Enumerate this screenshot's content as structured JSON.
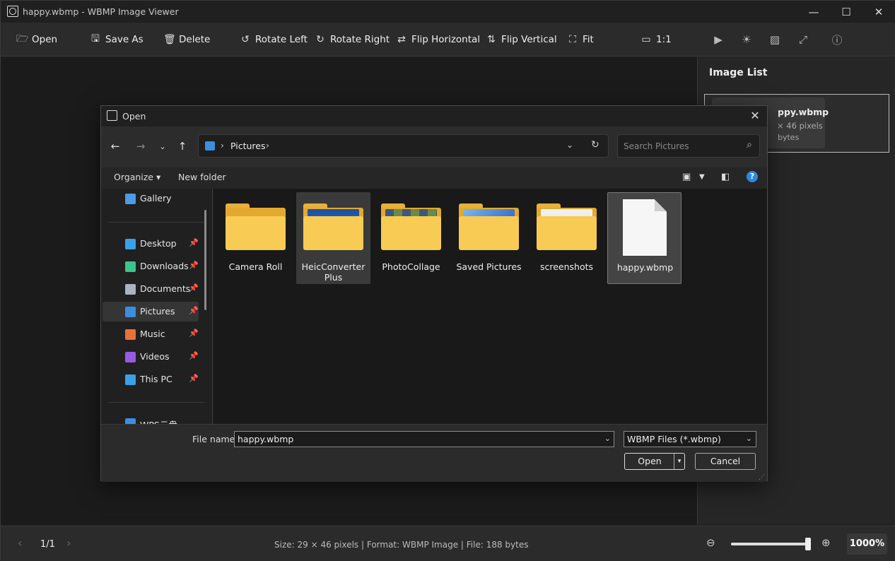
{
  "window": {
    "title": "happy.wbmp - WBMP Image Viewer",
    "minimize": "—",
    "maximize": "☐",
    "close": "✕"
  },
  "toolbar": {
    "open": "Open",
    "save_as": "Save As",
    "delete": "Delete",
    "rotate_left": "Rotate Left",
    "rotate_right": "Rotate Right",
    "flip_horizontal": "Flip Horizontal",
    "flip_vertical": "Flip Vertical",
    "fit": "Fit",
    "actual_size": "1:1"
  },
  "sidebar": {
    "title": "Image List",
    "thumb_name": "ppy.wbmp",
    "thumb_dims": "× 46 pixels",
    "thumb_size": "bytes"
  },
  "status": {
    "page": "1/1",
    "info": "Size: 29 × 46 pixels  |  Format: WBMP Image  |  File: 188 bytes",
    "zoom": "1000%",
    "zoom_level_fraction": 0.97
  },
  "dialog": {
    "title": "Open",
    "address_segment": "Pictures",
    "search_placeholder": "Search Pictures",
    "organize": "Organize",
    "new_folder": "New folder",
    "nav": [
      {
        "label": "Gallery",
        "pin": false,
        "icon": "gallery-icon",
        "color": "#4a9be8"
      },
      {
        "label": "Desktop",
        "pin": true,
        "icon": "desktop-icon",
        "color": "#3aa0e8"
      },
      {
        "label": "Downloads",
        "pin": true,
        "icon": "downloads-icon",
        "color": "#3cc48a"
      },
      {
        "label": "Documents",
        "pin": true,
        "icon": "documents-icon",
        "color": "#a8b4c4"
      },
      {
        "label": "Pictures",
        "pin": true,
        "icon": "pictures-icon",
        "color": "#3b8de0"
      },
      {
        "label": "Music",
        "pin": true,
        "icon": "music-icon",
        "color": "#e8703a"
      },
      {
        "label": "Videos",
        "pin": true,
        "icon": "videos-icon",
        "color": "#9a5ae0"
      },
      {
        "label": "This PC",
        "pin": true,
        "icon": "pc-icon",
        "color": "#3aa0e8"
      },
      {
        "label": "WPS云盘",
        "pin": false,
        "icon": "cloud-icon",
        "color": "#3a8ee8"
      }
    ],
    "files": [
      {
        "label": "Camera Roll",
        "type": "folder"
      },
      {
        "label": "HeicConverterPlus",
        "type": "folder"
      },
      {
        "label": "PhotoCollage",
        "type": "folder"
      },
      {
        "label": "Saved Pictures",
        "type": "folder"
      },
      {
        "label": "screenshots",
        "type": "folder"
      },
      {
        "label": "happy.wbmp",
        "type": "file"
      }
    ],
    "file_name_label": "File name:",
    "file_name_value": "happy.wbmp",
    "file_type": "WBMP Files (*.wbmp)",
    "open_button": "Open",
    "cancel_button": "Cancel"
  }
}
